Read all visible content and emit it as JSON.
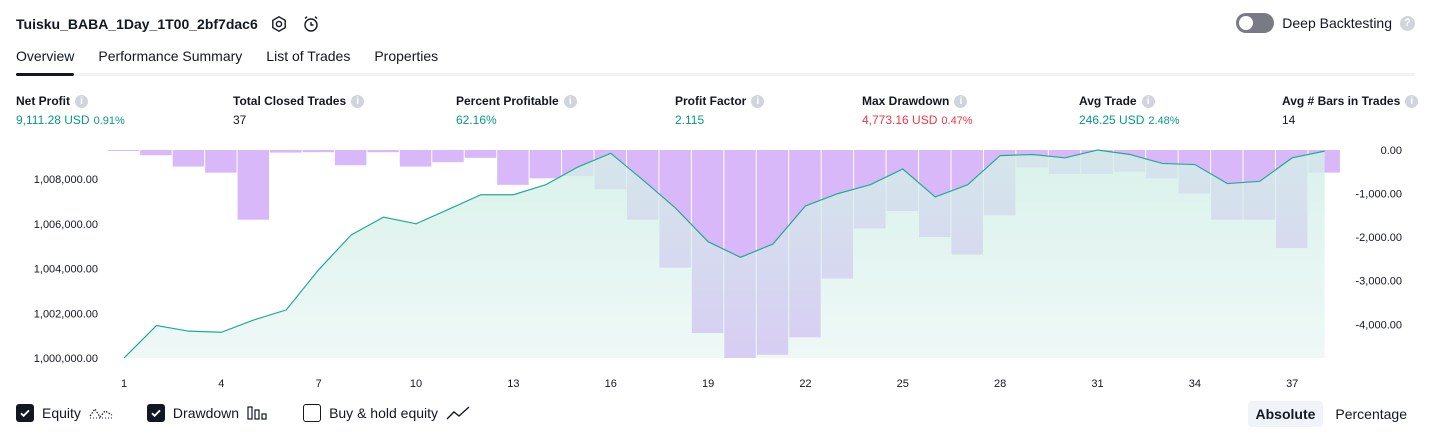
{
  "header": {
    "title": "Tuisku_BABA_1Day_1T00_2bf7dac6",
    "deep_backtesting_label": "Deep Backtesting",
    "deep_backtesting_enabled": false
  },
  "tabs": [
    {
      "label": "Overview",
      "active": true
    },
    {
      "label": "Performance Summary",
      "active": false
    },
    {
      "label": "List of Trades",
      "active": false
    },
    {
      "label": "Properties",
      "active": false
    }
  ],
  "metrics": {
    "net_profit": {
      "label": "Net Profit",
      "value": "9,111.28 USD",
      "pct": "0.91%"
    },
    "total_closed_trades": {
      "label": "Total Closed Trades",
      "value": "37"
    },
    "percent_profitable": {
      "label": "Percent Profitable",
      "value": "62.16%"
    },
    "profit_factor": {
      "label": "Profit Factor",
      "value": "2.115"
    },
    "max_drawdown": {
      "label": "Max Drawdown",
      "value": "4,773.16 USD",
      "pct": "0.47%"
    },
    "avg_trade": {
      "label": "Avg Trade",
      "value": "246.25 USD",
      "pct": "2.48%"
    },
    "avg_bars": {
      "label": "Avg # Bars in Trades",
      "value": "14"
    }
  },
  "chart_data": {
    "type": "area",
    "x_ticks": [
      1,
      4,
      7,
      10,
      13,
      16,
      19,
      22,
      25,
      28,
      31,
      34,
      37
    ],
    "equity": {
      "x": [
        1,
        2,
        3,
        4,
        5,
        6,
        7,
        8,
        9,
        10,
        11,
        12,
        13,
        14,
        15,
        16,
        17,
        18,
        19,
        20,
        21,
        22,
        23,
        24,
        25,
        26,
        27,
        28,
        29,
        30,
        31,
        32,
        33,
        34,
        35,
        36,
        37,
        38
      ],
      "values": [
        1000000,
        1001450,
        1001200,
        1001150,
        1001700,
        1002150,
        1003950,
        1005500,
        1006300,
        1006000,
        1006650,
        1007300,
        1007300,
        1007750,
        1008550,
        1009150,
        1007950,
        1006700,
        1005200,
        1004500,
        1005100,
        1006800,
        1007350,
        1007750,
        1008450,
        1007200,
        1007750,
        1009050,
        1009100,
        1008950,
        1009300,
        1009100,
        1008700,
        1008650,
        1007800,
        1007900,
        1008950,
        1009250
      ],
      "ylim": [
        1000000,
        1009300
      ],
      "left_ticks": [
        "1,000,000.00",
        "1,002,000.00",
        "1,004,000.00",
        "1,006,000.00",
        "1,008,000.00"
      ],
      "left_tick_values": [
        1000000,
        1002000,
        1004000,
        1006000,
        1008000
      ]
    },
    "drawdown": {
      "x": [
        1,
        2,
        3,
        4,
        5,
        6,
        7,
        8,
        9,
        10,
        11,
        12,
        13,
        14,
        15,
        16,
        17,
        18,
        19,
        20,
        21,
        22,
        23,
        24,
        25,
        26,
        27,
        28,
        29,
        30,
        31,
        32,
        33,
        34,
        35,
        36,
        37,
        38
      ],
      "values": [
        0,
        -120,
        -380,
        -520,
        -1600,
        -60,
        -50,
        -350,
        -50,
        -380,
        -280,
        -180,
        -800,
        -650,
        -600,
        -900,
        -1600,
        -2700,
        -4200,
        -4773.16,
        -4700,
        -4300,
        -2950,
        -1800,
        -1400,
        -2000,
        -2400,
        -1500,
        -400,
        -550,
        -550,
        -500,
        -650,
        -1000,
        -1600,
        -1600,
        -2250,
        -520
      ],
      "ylim": [
        -4773.16,
        0
      ],
      "right_ticks": [
        "0.00",
        "-1,000.00",
        "-2,000.00",
        "-3,000.00",
        "-4,000.00"
      ],
      "right_tick_values": [
        0,
        -1000,
        -2000,
        -3000,
        -4000
      ]
    },
    "colors": {
      "equity_line": "#22ab94",
      "equity_fill": "#d4efe8",
      "drawdown_bar": "#d9b8fa"
    }
  },
  "legend": {
    "equity": {
      "label": "Equity",
      "checked": true
    },
    "drawdown": {
      "label": "Drawdown",
      "checked": true
    },
    "buy_hold": {
      "label": "Buy & hold equity",
      "checked": false
    }
  },
  "modes": {
    "absolute": "Absolute",
    "percentage": "Percentage",
    "selected": "Absolute"
  }
}
